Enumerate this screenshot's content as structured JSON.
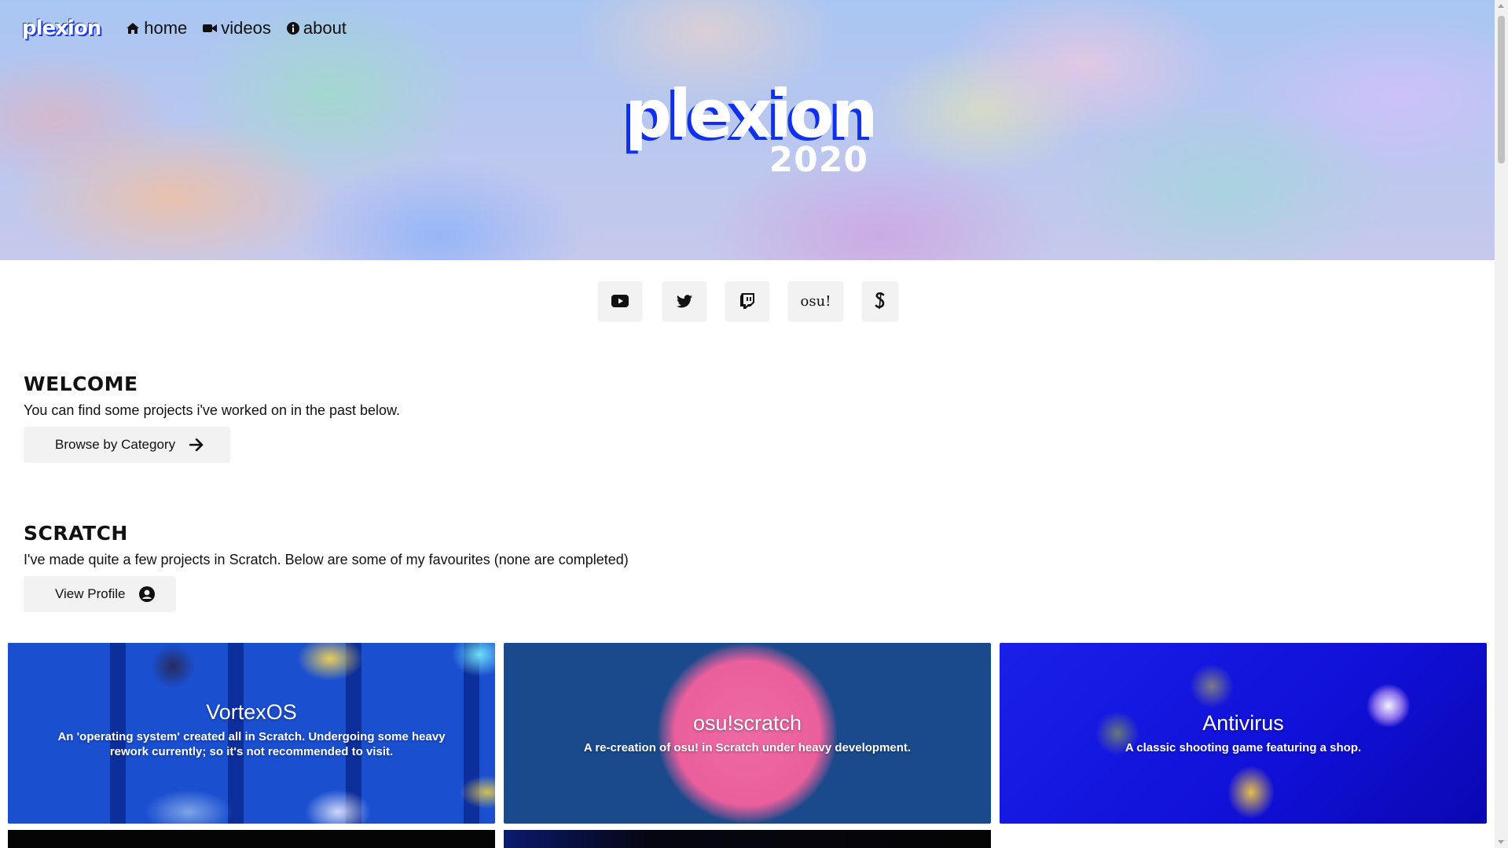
{
  "nav": {
    "logo": "plexion",
    "items": [
      {
        "label": "home",
        "icon": "home-icon"
      },
      {
        "label": "videos",
        "icon": "video-camera-icon"
      },
      {
        "label": "about",
        "icon": "info-circle-icon"
      }
    ]
  },
  "hero": {
    "logo_word": "plexion",
    "logo_year": "2020"
  },
  "social": [
    {
      "icon": "youtube-icon"
    },
    {
      "icon": "twitter-icon"
    },
    {
      "icon": "twitch-icon"
    },
    {
      "icon": "osu-text",
      "label": "osu!"
    },
    {
      "icon": "scratch-icon"
    }
  ],
  "welcome": {
    "title": "WELCOME",
    "text": "You can find some projects i've worked on in the past below.",
    "button": "Browse by Category"
  },
  "scratch": {
    "title": "SCRATCH",
    "text": "I've made quite a few projects in Scratch. Below are some of my favourites (none are completed)",
    "button": "View Profile"
  },
  "projects": [
    {
      "title": "VortexOS",
      "description": "An 'operating system' created all in Scratch. Undergoing some heavy rework currently; so it's not recommended to visit."
    },
    {
      "title": "osu!scratch",
      "description": "A re-creation of osu! in Scratch under heavy development."
    },
    {
      "title": "Antivirus",
      "description": "A classic shooting game featuring a shop."
    }
  ],
  "colors": {
    "logo_blue": "#1030f0",
    "button_bg": "#f2f2f2",
    "card2_bg": "#1a4a8c",
    "card2_circle": "#ea5f9c",
    "card3_bg": "#1010d8"
  }
}
